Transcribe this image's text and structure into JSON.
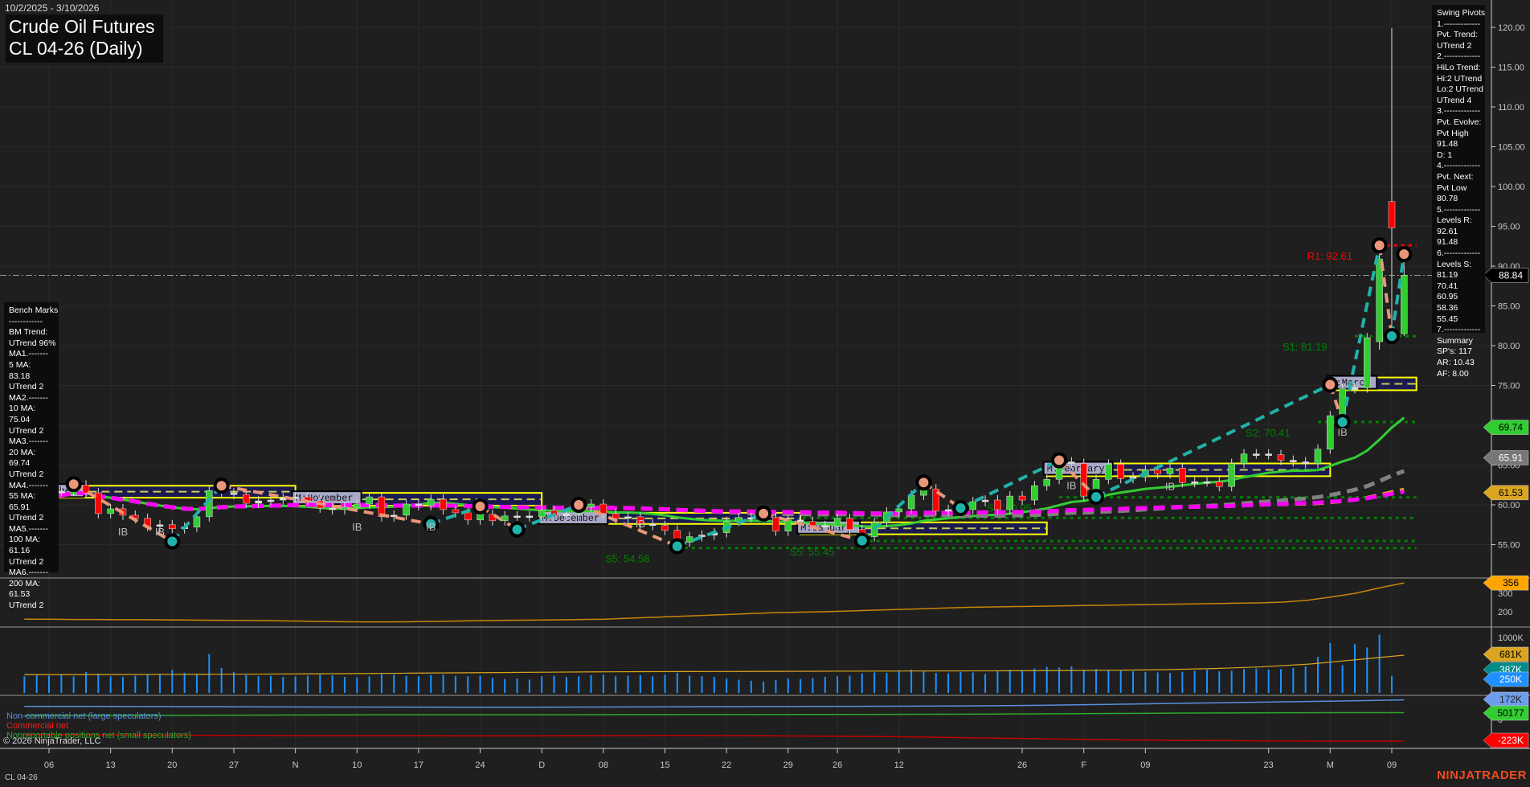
{
  "header": {
    "date_range": "10/2/2025 - 3/10/2026",
    "title_line1": "Crude Oil Futures",
    "title_line2": "CL 04-26 (Daily)"
  },
  "bench_marks": [
    "Bench Marks",
    "------------",
    "BM Trend:",
    "UTrend 96%",
    "MA1.-------",
    "5 MA:",
    "83.18",
    "UTrend 2",
    "MA2.-------",
    "10 MA:",
    "75.04",
    "UTrend 2",
    "MA3.-------",
    "20 MA:",
    "69.74",
    "UTrend 2",
    "MA4.-------",
    "55 MA:",
    "65.91",
    "UTrend 2",
    "MA5.-------",
    "100 MA:",
    "61.16",
    "UTrend 2",
    "MA6.-------",
    "200 MA:",
    "61.53",
    "UTrend 2"
  ],
  "swing_pivots": [
    "Swing Pivots",
    "1.-------------",
    "Pvt. Trend:",
    "UTrend 2",
    "2.-------------",
    "HiLo Trend:",
    "Hi:2 UTrend",
    "Lo:2 UTrend",
    "UTrend 4",
    "3.-------------",
    "Pvt. Evolve:",
    "Pvt High",
    "91.48",
    "D: 1",
    "4.-------------",
    "Pvt. Next:",
    "Pvt Low",
    "80.78",
    "5.-------------",
    "Levels R:",
    "92.61",
    "91.48",
    "6.-------------",
    "Levels S:",
    "81.19",
    "70.41",
    "60.95",
    "58.36",
    "55.45",
    "7.-------------",
    "Summary",
    "SP's: 117",
    "AR: 10.43",
    "AF: 8.00"
  ],
  "legend": {
    "noncommercial": "Non-commercial net (large speculators)",
    "commercial": "Commercial net",
    "nonreportable": "Nonreportable positions net (small speculators)"
  },
  "footer": {
    "copyright": "© 2026 NinjaTrader, LLC",
    "instrument": "CL 04-26",
    "brand": "NINJATRADER"
  },
  "colors": {
    "up": "#32cd32",
    "down": "#ff0000",
    "ma20": "#32cd32",
    "ma55": "#808080",
    "ma100": "#daa520",
    "ma200": "#ff00ff",
    "swing_up": "#20b2aa",
    "swing_down": "#e9967a",
    "month_box": "#ffff00",
    "support": "#008000",
    "resistance": "#ff0000"
  },
  "chart_data": {
    "type": "candlestick",
    "title": "Crude Oil Futures CL 04-26 (Daily)",
    "ylim": [
      52,
      122
    ],
    "y_ticks": [
      "55.00",
      "60.00",
      "65.00",
      "70.00",
      "75.00",
      "80.00",
      "85.00",
      "90.00",
      "95.00",
      "100.00",
      "105.00",
      "110.00",
      "115.00",
      "120.00"
    ],
    "x_ticks": [
      {
        "label": "06",
        "index": 2
      },
      {
        "label": "13",
        "index": 7
      },
      {
        "label": "20",
        "index": 12
      },
      {
        "label": "27",
        "index": 17
      },
      {
        "label": "N",
        "index": 22
      },
      {
        "label": "10",
        "index": 27
      },
      {
        "label": "17",
        "index": 32
      },
      {
        "label": "24",
        "index": 37
      },
      {
        "label": "D",
        "index": 42
      },
      {
        "label": "08",
        "index": 47
      },
      {
        "label": "15",
        "index": 52
      },
      {
        "label": "22",
        "index": 57
      },
      {
        "label": "29",
        "index": 62
      },
      {
        "label": "26",
        "index": 66
      },
      {
        "label": "12",
        "index": 71
      },
      {
        "label": "26",
        "index": 81
      },
      {
        "label": "F",
        "index": 86
      },
      {
        "label": "09",
        "index": 91
      },
      {
        "label": "23",
        "index": 101
      },
      {
        "label": "M",
        "index": 106
      },
      {
        "label": "09",
        "index": 111
      }
    ],
    "closes": [
      60.5,
      60.9,
      61.7,
      61.7,
      62.5,
      61.5,
      58.9,
      59.5,
      58.7,
      58.3,
      57.3,
      57.5,
      57.0,
      57.2,
      58.5,
      61.8,
      61.5,
      61.3,
      60.2,
      60.5,
      60.6,
      60.9,
      61.0,
      60.5,
      59.6,
      59.4,
      59.7,
      60.1,
      61.0,
      58.5,
      58.7,
      60.1,
      59.9,
      60.7,
      59.4,
      59.0,
      58.1,
      58.8,
      58.0,
      58.6,
      58.6,
      58.5,
      59.3,
      58.6,
      58.9,
      59.7,
      60.1,
      58.9,
      58.3,
      58.5,
      57.6,
      57.4,
      56.8,
      55.3,
      56.0,
      56.2,
      56.5,
      57.9,
      58.4,
      58.4,
      58.4,
      56.7,
      58.1,
      57.9,
      57.4,
      57.3,
      58.3,
      56.9,
      56.0,
      57.8,
      59.1,
      59.5,
      61.2,
      62.0,
      59.2,
      59.4,
      59.4,
      60.4,
      60.6,
      59.4,
      61.1,
      60.6,
      62.4,
      63.2,
      65.4,
      65.2,
      61.1,
      63.2,
      65.1,
      63.3,
      63.5,
      64.4,
      63.9,
      64.6,
      62.8,
      62.9,
      62.9,
      62.3,
      65.2,
      66.4,
      66.4,
      66.3,
      65.6,
      65.4,
      65.2,
      67.0,
      71.2,
      74.6,
      74.7,
      81.0,
      90.9,
      94.8,
      88.84
    ],
    "overrides": {
      "110": {
        "o": 80.5,
        "h": 92.6,
        "l": 79.5,
        "c": 90.9
      },
      "111": {
        "o": 98.1,
        "h": 119.9,
        "l": 80.8,
        "c": 94.8
      },
      "112": {
        "o": 81.5,
        "h": 91.5,
        "l": 81.2,
        "c": 88.84
      }
    },
    "last_price": "88.84",
    "moving_averages": [
      {
        "name": "20 MA",
        "period": 20,
        "value": "69.74",
        "style": "solid"
      },
      {
        "name": "55 MA",
        "period": 55,
        "value": "65.91",
        "style": "dashed"
      },
      {
        "name": "100 MA",
        "period": 100,
        "value": "61.16",
        "style": "dashed"
      },
      {
        "name": "200 MA",
        "period": 200,
        "value": "61.53",
        "style": "dashed"
      }
    ],
    "swing_pivots": [
      [
        4,
        62.6,
        "H"
      ],
      [
        12,
        55.4,
        "L"
      ],
      [
        16,
        62.4,
        "H"
      ],
      [
        33,
        57.6,
        "L"
      ],
      [
        37,
        59.8,
        "H"
      ],
      [
        40,
        56.9,
        "L"
      ],
      [
        45,
        60.0,
        "H"
      ],
      [
        53,
        54.8,
        "L"
      ],
      [
        60,
        58.9,
        "H"
      ],
      [
        68,
        55.5,
        "L"
      ],
      [
        73,
        62.8,
        "H"
      ],
      [
        76,
        59.6,
        "L"
      ],
      [
        84,
        65.6,
        "H"
      ],
      [
        87,
        61.0,
        "L"
      ],
      [
        106,
        75.1,
        "H"
      ],
      [
        107,
        70.4,
        "L"
      ],
      [
        110,
        92.6,
        "H"
      ],
      [
        111,
        81.2,
        "L"
      ],
      [
        112,
        91.5,
        "H"
      ]
    ],
    "levels": [
      {
        "label": "R1: 92.61",
        "price": 92.61,
        "from": 110,
        "kind": "resistance",
        "show_label": true
      },
      {
        "label": "S1: 81.19",
        "price": 81.19,
        "from": 108,
        "kind": "support",
        "show_label": true
      },
      {
        "label": "S2: 70.41",
        "price": 70.41,
        "from": 105,
        "kind": "support",
        "show_label": true
      },
      {
        "label": "S3: 60.95",
        "price": 60.95,
        "from": 84,
        "kind": "support",
        "show_label": true
      },
      {
        "label": "S4: 58.36",
        "price": 58.36,
        "from": 62,
        "kind": "support",
        "show_label": false
      },
      {
        "label": "S5: 55.45",
        "price": 55.45,
        "from": 68,
        "kind": "support",
        "show_label": true
      },
      {
        "label": "S5: 54.58",
        "price": 54.58,
        "from": 53,
        "kind": "support",
        "show_label": true
      }
    ],
    "month_boxes": [
      {
        "label": "M:October",
        "start": 0,
        "end": 22,
        "lo": 60.9,
        "hi": 62.4
      },
      {
        "label": "M:November",
        "start": 22,
        "end": 42,
        "lo": 59.9,
        "hi": 61.5
      },
      {
        "label": "M:December",
        "start": 42,
        "end": 63,
        "lo": 57.6,
        "hi": 59.0
      },
      {
        "label": "M:January",
        "start": 63,
        "end": 83,
        "lo": 56.3,
        "hi": 57.8
      },
      {
        "label": "M:February",
        "start": 83,
        "end": 106,
        "lo": 63.6,
        "hi": 65.2
      },
      {
        "label": "M:March",
        "start": 106,
        "end": 113,
        "lo": 74.4,
        "hi": 76.0
      }
    ],
    "ib_markers": [
      [
        8,
        57.6
      ],
      [
        11,
        57.6
      ],
      [
        27,
        58.2
      ],
      [
        33,
        58.2
      ],
      [
        50,
        58.6
      ],
      [
        85,
        63.4
      ],
      [
        93,
        63.3
      ],
      [
        107,
        70.1
      ]
    ],
    "indicator_panel": {
      "y_ticks": [
        "300",
        "200"
      ],
      "last": "356",
      "values": [
        160,
        160,
        158,
        158,
        157,
        157,
        156,
        155,
        154,
        153,
        152,
        150,
        148,
        146,
        145,
        145,
        146,
        148,
        150,
        152,
        154,
        155,
        156,
        158,
        160,
        165,
        170,
        175,
        180,
        185,
        190,
        195,
        198,
        200,
        204,
        208,
        212,
        216,
        220,
        224,
        226,
        228,
        230,
        232,
        234,
        236,
        238,
        240,
        242,
        244,
        246,
        248,
        252,
        262,
        280,
        300,
        330,
        356
      ]
    },
    "volume_panel": {
      "y_ticks": [
        "1000K"
      ],
      "labels": [
        "681K",
        "387K",
        "250K"
      ],
      "volumes": [
        300,
        320,
        310,
        330,
        300,
        380,
        350,
        300,
        290,
        310,
        340,
        330,
        420,
        360,
        340,
        700,
        450,
        380,
        320,
        300,
        310,
        290,
        300,
        310,
        330,
        320,
        290,
        280,
        300,
        340,
        330,
        310,
        300,
        320,
        330,
        310,
        300,
        310,
        270,
        250,
        260,
        240,
        300,
        310,
        290,
        300,
        320,
        330,
        300,
        310,
        320,
        300,
        330,
        360,
        310,
        300,
        290,
        260,
        240,
        220,
        200,
        230,
        260,
        250,
        270,
        290,
        300,
        310,
        350,
        370,
        360,
        400,
        420,
        390,
        360,
        350,
        380,
        370,
        340,
        390,
        420,
        410,
        440,
        470,
        460,
        480,
        420,
        430,
        420,
        400,
        390,
        380,
        370,
        360,
        380,
        400,
        420,
        390,
        400,
        430,
        440,
        420,
        430,
        450,
        480,
        650,
        900,
        500,
        880,
        820,
        1050,
        310
      ],
      "avg": [
        330,
        330,
        332,
        334,
        336,
        340,
        344,
        350,
        356,
        362,
        368,
        374,
        380,
        384,
        386,
        388,
        390,
        392,
        394,
        396,
        398,
        400,
        404,
        410,
        420,
        440,
        470,
        520,
        600,
        681
      ]
    },
    "cot_panel": {
      "labels": [
        "172K",
        "50177",
        "0",
        "-223K"
      ],
      "noncommercial": [
        110,
        110,
        108,
        106,
        104,
        103,
        102,
        102,
        104,
        106,
        108,
        110,
        112,
        114,
        120,
        130,
        140,
        150,
        160,
        172
      ],
      "commercial": [
        -160,
        -162,
        -165,
        -168,
        -170,
        -170,
        -172,
        -172,
        -170,
        -168,
        -170,
        -175,
        -180,
        -190,
        -200,
        -210,
        -215,
        -220,
        -223,
        -223
      ],
      "nonreportable": [
        20,
        22,
        24,
        26,
        28,
        30,
        30,
        30,
        31,
        32,
        32,
        33,
        34,
        36,
        38,
        42,
        46,
        48,
        50,
        50
      ]
    }
  }
}
